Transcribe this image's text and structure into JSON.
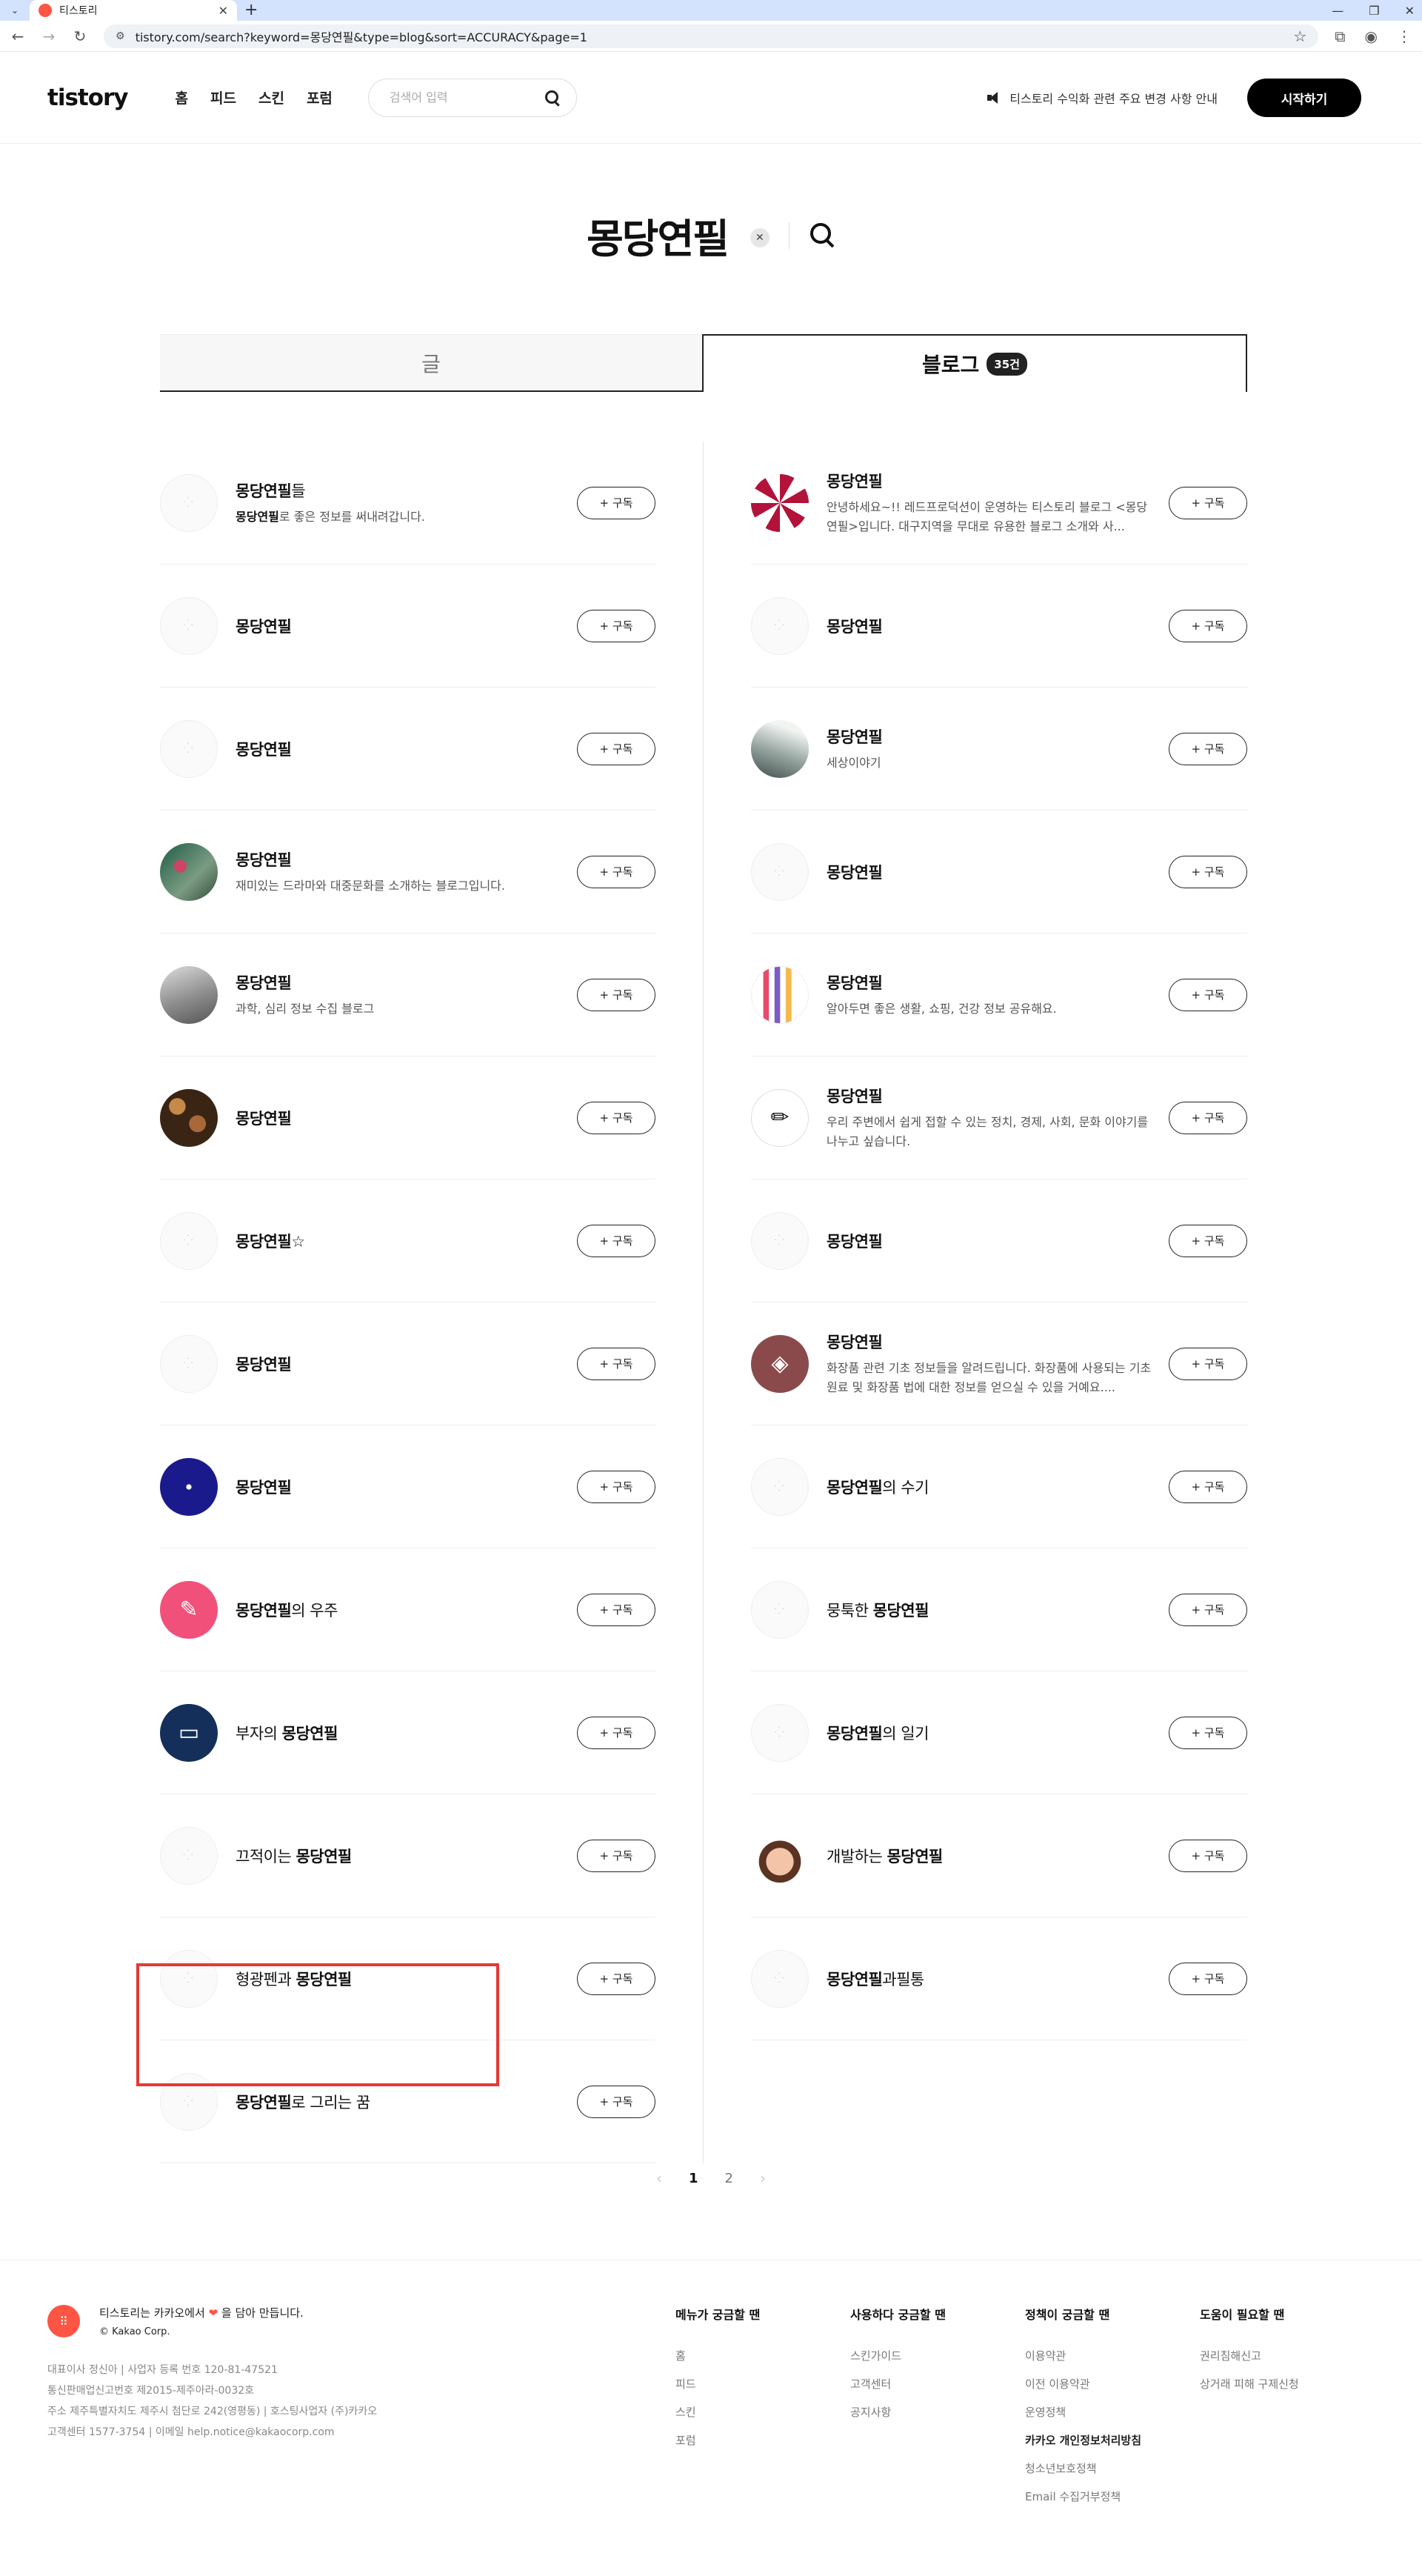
{
  "browser": {
    "tab_title": "티스토리",
    "url": "tistory.com/search?keyword=몽당연필&type=blog&sort=ACCURACY&page=1"
  },
  "header": {
    "logo": "tistory",
    "nav": [
      "홈",
      "피드",
      "스킨",
      "포럼"
    ],
    "search_placeholder": "검색어 입력",
    "notice": "티스토리 수익화 관련 주요 변경 사항 안내",
    "start_button": "시작하기"
  },
  "query": {
    "keyword": "몽당연필"
  },
  "tabs": {
    "posts": "글",
    "blogs": "블로그",
    "blog_count": "35건"
  },
  "subscribe_label": "+ 구독",
  "results": {
    "left": [
      {
        "pre": "",
        "hl": "몽당연필",
        "post": "들",
        "desc_hl": "몽당연필",
        "desc": "로 좋은 정보를 써내려갑니다.",
        "avatar": "default"
      },
      {
        "pre": "",
        "hl": "몽당연필",
        "post": "",
        "desc_hl": "",
        "desc": "",
        "avatar": "default"
      },
      {
        "pre": "",
        "hl": "몽당연필",
        "post": "",
        "desc_hl": "",
        "desc": "",
        "avatar": "default"
      },
      {
        "pre": "",
        "hl": "몽당연필",
        "post": "",
        "desc_hl": "",
        "desc": "재미있는 드라마와 대중문화를 소개하는 블로그입니다.",
        "avatar": "green"
      },
      {
        "pre": "",
        "hl": "몽당연필",
        "post": "",
        "desc_hl": "",
        "desc": "과학, 심리 정보 수집 블로그",
        "avatar": "grey"
      },
      {
        "pre": "",
        "hl": "몽당연필",
        "post": "",
        "desc_hl": "",
        "desc": "",
        "avatar": "brown"
      },
      {
        "pre": "",
        "hl": "몽당연필",
        "post": "☆",
        "desc_hl": "",
        "desc": "",
        "avatar": "default"
      },
      {
        "pre": "",
        "hl": "몽당연필",
        "post": "",
        "desc_hl": "",
        "desc": "",
        "avatar": "default"
      },
      {
        "pre": "",
        "hl": "몽당연필",
        "post": "",
        "desc_hl": "",
        "desc": "",
        "avatar": "navy"
      },
      {
        "pre": "",
        "hl": "몽당연필",
        "post": "의 우주",
        "desc_hl": "",
        "desc": "",
        "avatar": "pink"
      },
      {
        "pre": "부자의 ",
        "hl": "몽당연필",
        "post": "",
        "desc_hl": "",
        "desc": "",
        "avatar": "darkblue"
      },
      {
        "pre": "끄적이는 ",
        "hl": "몽당연필",
        "post": "",
        "desc_hl": "",
        "desc": "",
        "avatar": "default"
      },
      {
        "pre": "형광펜과 ",
        "hl": "몽당연필",
        "post": "",
        "desc_hl": "",
        "desc": "",
        "avatar": "default"
      },
      {
        "pre": "",
        "hl": "몽당연필",
        "post": "로 그리는 꿈",
        "desc_hl": "",
        "desc": "",
        "avatar": "default"
      }
    ],
    "right": [
      {
        "pre": "",
        "hl": "몽당연필",
        "post": "",
        "desc_hl": "",
        "desc": "안녕하세요~!! 레드프로덕션이 운영하는 티스토리 블로그 <몽당연필>입니다. 대구지역을 무대로 유용한 블로그 소개와 사...",
        "avatar": "red"
      },
      {
        "pre": "",
        "hl": "몽당연필",
        "post": "",
        "desc_hl": "",
        "desc": "",
        "avatar": "default"
      },
      {
        "pre": "",
        "hl": "몽당연필",
        "post": "",
        "desc_hl": "",
        "desc": "세상이야기",
        "avatar": "paper"
      },
      {
        "pre": "",
        "hl": "몽당연필",
        "post": "",
        "desc_hl": "",
        "desc": "",
        "avatar": "default"
      },
      {
        "pre": "",
        "hl": "몽당연필",
        "post": "",
        "desc_hl": "",
        "desc": "알아두면 좋은 생활, 쇼핑, 건강 정보 공유해요.",
        "avatar": "pencils"
      },
      {
        "pre": "",
        "hl": "몽당연필",
        "post": "",
        "desc_hl": "",
        "desc": "우리 주변에서 쉽게 접할 수 있는 정치, 경제, 사회, 문화 이야기를 나누고 싶습니다.",
        "avatar": "pencil"
      },
      {
        "pre": "",
        "hl": "몽당연필",
        "post": "",
        "desc_hl": "",
        "desc": "",
        "avatar": "default"
      },
      {
        "pre": "",
        "hl": "몽당연필",
        "post": "",
        "desc_hl": "",
        "desc": "화장품 관련 기초 정보들을 알려드립니다. 화장품에 사용되는 기초 원료 및 화장품 법에 대한 정보를 얻으실 수 있을 거예요....",
        "avatar": "maroon"
      },
      {
        "pre": "",
        "hl": "몽당연필",
        "post": "의 수기",
        "desc_hl": "",
        "desc": "",
        "avatar": "default"
      },
      {
        "pre": "뭉툭한 ",
        "hl": "몽당연필",
        "post": "",
        "desc_hl": "",
        "desc": "",
        "avatar": "default"
      },
      {
        "pre": "",
        "hl": "몽당연필",
        "post": "의 일기",
        "desc_hl": "",
        "desc": "",
        "avatar": "default"
      },
      {
        "pre": "개발하는 ",
        "hl": "몽당연필",
        "post": "",
        "desc_hl": "",
        "desc": "",
        "avatar": "memoji"
      },
      {
        "pre": "",
        "hl": "몽당연필",
        "post": "과필통",
        "desc_hl": "",
        "desc": "",
        "avatar": "default"
      }
    ]
  },
  "pagination": {
    "prev": "‹",
    "pages": [
      "1",
      "2"
    ],
    "current": "1",
    "next": "›"
  },
  "footer": {
    "made_pre": "티스토리는 카카오에서",
    "made_post": "을 담아 만듭니다.",
    "copyright": "© Kakao Corp.",
    "info": [
      "대표이사 정신아 | 사업자 등록 번호 120-81-47521",
      "통신판매업신고번호 제2015-제주아라-0032호",
      "주소 제주특별자치도 제주시 첨단로 242(영평동) | 호스팅사업자 (주)카카오",
      "고객센터 1577-3754 | 이메일 help.notice@kakaocorp.com"
    ],
    "columns": [
      {
        "title": "메뉴가 궁금할 땐",
        "links": [
          "홈",
          "피드",
          "스킨",
          "포럼"
        ]
      },
      {
        "title": "사용하다 궁금할 땐",
        "links": [
          "스킨가이드",
          "고객센터",
          "공지사항"
        ]
      },
      {
        "title": "정책이 궁금할 땐",
        "links": [
          "이용약관",
          "이전 이용약관",
          "운영정책",
          "카카오 개인정보처리방침",
          "청소년보호정책",
          "Email 수집거부정책"
        ]
      },
      {
        "title": "도움이 필요할 땐",
        "links": [
          "권리침해신고",
          "상거래 피해 구제신청"
        ]
      }
    ]
  }
}
